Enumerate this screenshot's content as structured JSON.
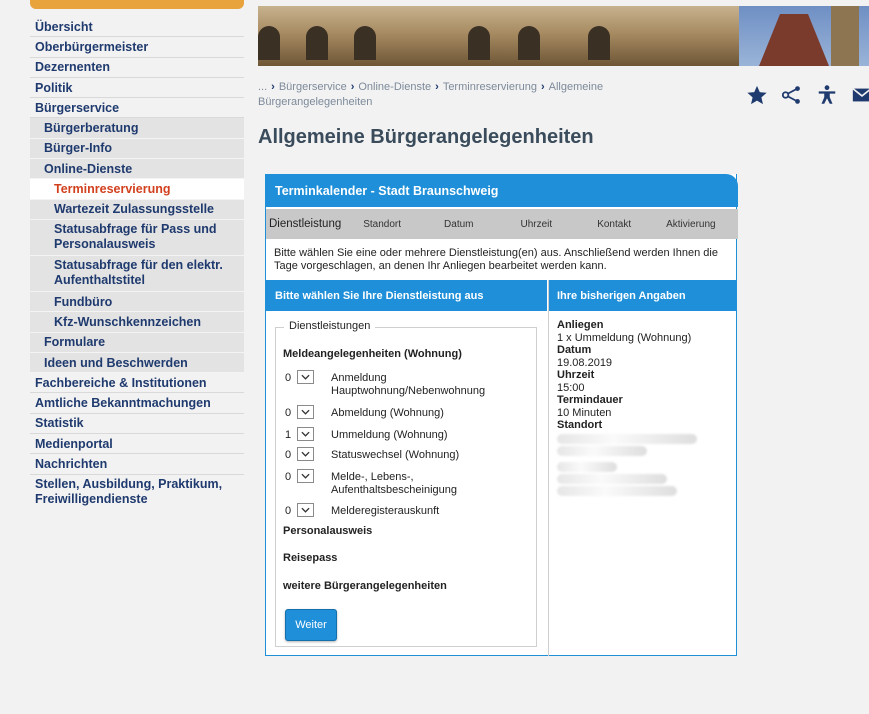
{
  "sidebar": {
    "items": [
      {
        "label": "Übersicht",
        "level": 1
      },
      {
        "label": "Oberbürgermeister",
        "level": 1
      },
      {
        "label": "Dezernenten",
        "level": 1
      },
      {
        "label": "Politik",
        "level": 1
      },
      {
        "label": "Bürgerservice",
        "level": 1
      },
      {
        "label": "Bürgerberatung",
        "level": 2
      },
      {
        "label": "Bürger-Info",
        "level": 2
      },
      {
        "label": "Online-Dienste",
        "level": 2
      },
      {
        "label": "Terminreservierung",
        "level": 3,
        "active": true
      },
      {
        "label": "Wartezeit Zulassungsstelle",
        "level": 3
      },
      {
        "label": "Statusabfrage für Pass und Personalausweis",
        "level": 3
      },
      {
        "label": "Statusabfrage für den elektr. Aufenthaltstitel",
        "level": 3
      },
      {
        "label": "Fundbüro",
        "level": 3
      },
      {
        "label": "Kfz-Wunschkennzeichen",
        "level": 3
      },
      {
        "label": "Formulare",
        "level": 2
      },
      {
        "label": "Ideen und Beschwerden",
        "level": 2
      },
      {
        "label": "Fachbereiche & Institutionen",
        "level": 1
      },
      {
        "label": "Amtliche Bekanntmachungen",
        "level": 1
      },
      {
        "label": "Statistik",
        "level": 1
      },
      {
        "label": "Medienportal",
        "level": 1
      },
      {
        "label": "Nachrichten",
        "level": 1
      },
      {
        "label": "Stellen, Ausbildung, Praktikum, Freiwilligendienste",
        "level": 1
      }
    ]
  },
  "breadcrumb": {
    "ellipsis": "...",
    "items": [
      "Bürgerservice",
      "Online-Dienste",
      "Terminreservierung",
      "Allgemeine Bürgerangelegenheiten"
    ]
  },
  "tools": [
    "star-icon",
    "share-icon",
    "accessibility-icon",
    "mail-icon"
  ],
  "page_title": "Allgemeine Bürgerangelegenheiten",
  "calendar": {
    "title": "Terminkalender - Stadt Braunschweig",
    "steps": [
      "Dienstleistung",
      "Standort",
      "Datum",
      "Uhrzeit",
      "Kontakt",
      "Aktivierung"
    ],
    "intro": "Bitte wählen Sie eine oder mehrere Dienstleistung(en) aus. Anschließend werden Ihnen die Tage vorgeschlagen, an denen Ihr Anliegen bearbeitet werden kann.",
    "left_header": "Bitte wählen Sie Ihre Dienstleistung aus",
    "right_header": "Ihre bisherigen Angaben",
    "legend": "Dienstleistungen",
    "groups": {
      "melde": "Meldeangelegenheiten (Wohnung)",
      "perso": "Personalausweis",
      "reise": "Reisepass",
      "weitere": "weitere Bürgerangelegenheiten"
    },
    "services": [
      {
        "qty": "0",
        "label": "Anmeldung Hauptwohnung/Nebenwohnung"
      },
      {
        "qty": "0",
        "label": "Abmeldung (Wohnung)"
      },
      {
        "qty": "1",
        "label": "Ummeldung (Wohnung)"
      },
      {
        "qty": "0",
        "label": "Statuswechsel (Wohnung)"
      },
      {
        "qty": "0",
        "label": "Melde-, Lebens-, Aufenthaltsbescheinigung"
      },
      {
        "qty": "0",
        "label": "Melderegisterauskunft"
      }
    ],
    "submit": "Weiter",
    "summary": {
      "anliegen_label": "Anliegen",
      "anliegen_value": "1 x Ummeldung (Wohnung)",
      "datum_label": "Datum",
      "datum_value": "19.08.2019",
      "uhrzeit_label": "Uhrzeit",
      "uhrzeit_value": "15:00",
      "dauer_label": "Termindauer",
      "dauer_value": "10 Minuten",
      "standort_label": "Standort"
    }
  }
}
